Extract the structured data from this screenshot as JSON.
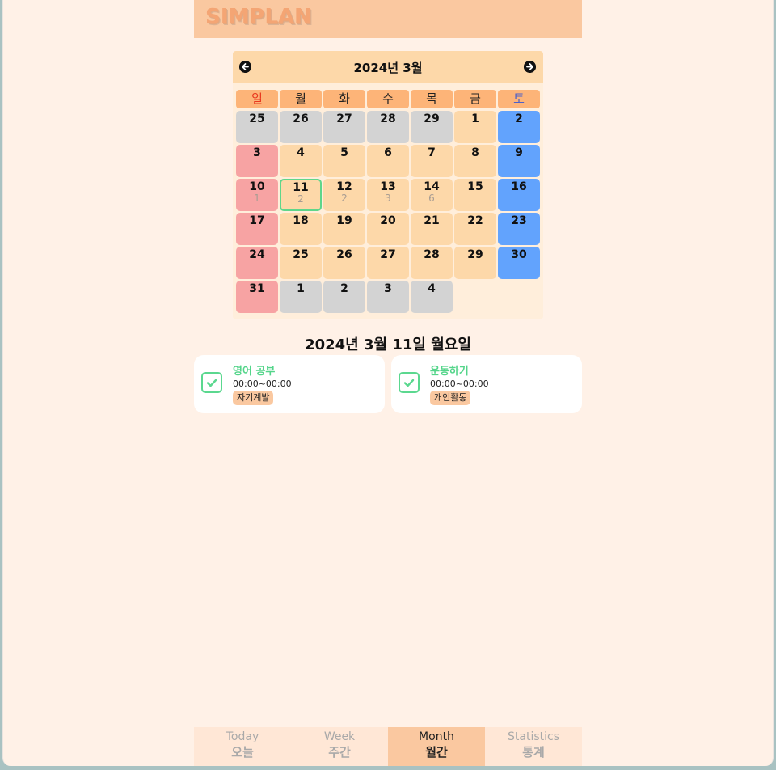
{
  "app": {
    "logo": "SIMPLAN"
  },
  "calendar": {
    "title": "2024년 3월",
    "weekdays": [
      "일",
      "월",
      "화",
      "수",
      "목",
      "금",
      "토"
    ],
    "weeks": [
      [
        {
          "day": "25",
          "type": "other"
        },
        {
          "day": "26",
          "type": "other"
        },
        {
          "day": "27",
          "type": "other"
        },
        {
          "day": "28",
          "type": "other"
        },
        {
          "day": "29",
          "type": "other"
        },
        {
          "day": "1",
          "type": "normal"
        },
        {
          "day": "2",
          "type": "sat"
        }
      ],
      [
        {
          "day": "3",
          "type": "sun"
        },
        {
          "day": "4",
          "type": "normal"
        },
        {
          "day": "5",
          "type": "normal"
        },
        {
          "day": "6",
          "type": "normal"
        },
        {
          "day": "7",
          "type": "normal"
        },
        {
          "day": "8",
          "type": "normal"
        },
        {
          "day": "9",
          "type": "sat"
        }
      ],
      [
        {
          "day": "10",
          "type": "sun",
          "count": "1"
        },
        {
          "day": "11",
          "type": "normal",
          "count": "2",
          "selected": true
        },
        {
          "day": "12",
          "type": "normal",
          "count": "2"
        },
        {
          "day": "13",
          "type": "normal",
          "count": "3"
        },
        {
          "day": "14",
          "type": "normal",
          "count": "6"
        },
        {
          "day": "15",
          "type": "normal"
        },
        {
          "day": "16",
          "type": "sat"
        }
      ],
      [
        {
          "day": "17",
          "type": "sun"
        },
        {
          "day": "18",
          "type": "normal"
        },
        {
          "day": "19",
          "type": "normal"
        },
        {
          "day": "20",
          "type": "normal"
        },
        {
          "day": "21",
          "type": "normal"
        },
        {
          "day": "22",
          "type": "normal"
        },
        {
          "day": "23",
          "type": "sat"
        }
      ],
      [
        {
          "day": "24",
          "type": "sun"
        },
        {
          "day": "25",
          "type": "normal"
        },
        {
          "day": "26",
          "type": "normal"
        },
        {
          "day": "27",
          "type": "normal"
        },
        {
          "day": "28",
          "type": "normal"
        },
        {
          "day": "29",
          "type": "normal"
        },
        {
          "day": "30",
          "type": "sat"
        }
      ],
      [
        {
          "day": "31",
          "type": "sun"
        },
        {
          "day": "1",
          "type": "other"
        },
        {
          "day": "2",
          "type": "other"
        },
        {
          "day": "3",
          "type": "other"
        },
        {
          "day": "4",
          "type": "other"
        }
      ]
    ]
  },
  "selected_date": "2024년 3월 11일 월요일",
  "tasks": [
    {
      "title": "영어 공부",
      "time": "00:00~00:00",
      "tag": "자기계발",
      "done": true
    },
    {
      "title": "운동하기",
      "time": "00:00~00:00",
      "tag": "개인활동",
      "done": true
    }
  ],
  "bottom_nav": [
    {
      "en": "Today",
      "ko": "오늘",
      "active": false
    },
    {
      "en": "Week",
      "ko": "주간",
      "active": false
    },
    {
      "en": "Month",
      "ko": "월간",
      "active": true
    },
    {
      "en": "Statistics",
      "ko": "통계",
      "active": false
    }
  ],
  "colors": {
    "header": "#fac8a0",
    "background": "#fff1e7",
    "sunday": "#f7a3a3",
    "saturday": "#62a3fd",
    "check": "#5bd88f"
  }
}
